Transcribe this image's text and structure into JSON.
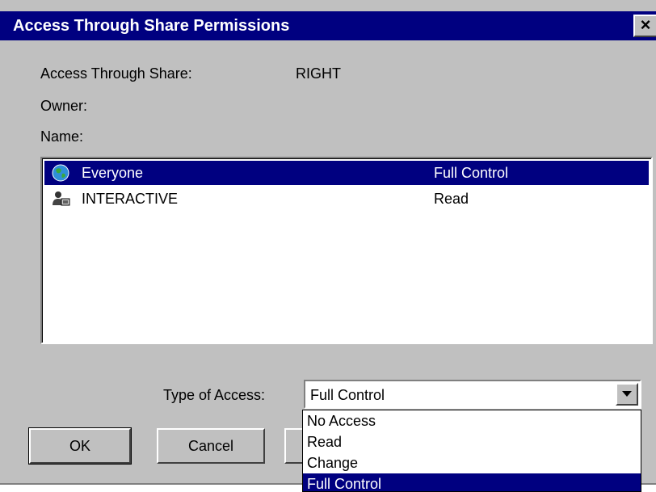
{
  "window": {
    "title": "Access Through Share Permissions",
    "close_label": "×"
  },
  "fields": {
    "share_label": "Access Through Share:",
    "share_value": "RIGHT",
    "owner_label": "Owner:",
    "name_label": "Name:"
  },
  "permissions": [
    {
      "name": "Everyone",
      "access": "Full Control",
      "icon": "globe-icon",
      "selected": true
    },
    {
      "name": "INTERACTIVE",
      "access": "Read",
      "icon": "interactive-user-icon",
      "selected": false
    }
  ],
  "type_of_access": {
    "label": "Type of Access:",
    "value": "Full Control",
    "options": [
      "No Access",
      "Read",
      "Change",
      "Full Control"
    ],
    "highlighted": "Full Control"
  },
  "buttons": {
    "ok": "OK",
    "cancel": "Cancel"
  },
  "colors": {
    "titlebar": "#000080",
    "dialog_bg": "#c0c0c0",
    "selection": "#000080"
  }
}
